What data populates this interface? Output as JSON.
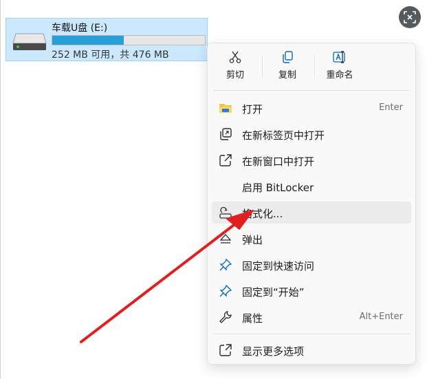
{
  "drive": {
    "name": "车载U盘 (E:)",
    "space": "252 MB 可用，共 476 MB",
    "used_fraction": 0.47
  },
  "quick_actions": [
    {
      "label": "剪切",
      "icon": "scissors-icon"
    },
    {
      "label": "复制",
      "icon": "copy-icon"
    },
    {
      "label": "重命名",
      "icon": "rename-icon"
    }
  ],
  "menu_items": [
    {
      "label": "打开",
      "shortcut": "Enter",
      "icon": "folder-icon"
    },
    {
      "label": "在新标签页中打开",
      "shortcut": "",
      "icon": "new-tab-icon"
    },
    {
      "label": "在新窗口中打开",
      "shortcut": "",
      "icon": "new-window-icon"
    },
    {
      "label": "启用 BitLocker",
      "shortcut": "",
      "icon": ""
    },
    {
      "label": "格式化...",
      "shortcut": "",
      "icon": "format-icon"
    },
    {
      "label": "弹出",
      "shortcut": "",
      "icon": "eject-icon"
    },
    {
      "label": "固定到快速访问",
      "shortcut": "",
      "icon": "pin-icon"
    },
    {
      "label": "固定到“开始”",
      "shortcut": "",
      "icon": "pin-icon"
    },
    {
      "label": "属性",
      "shortcut": "Alt+Enter",
      "icon": "wrench-icon"
    },
    {
      "label": "显示更多选项",
      "shortcut": "",
      "icon": "more-options-icon"
    }
  ],
  "colors": {
    "accent": "#0078d4",
    "drive_fill": "#26a0da",
    "selection": "#cce8ff",
    "annotation_arrow": "#e02020"
  }
}
